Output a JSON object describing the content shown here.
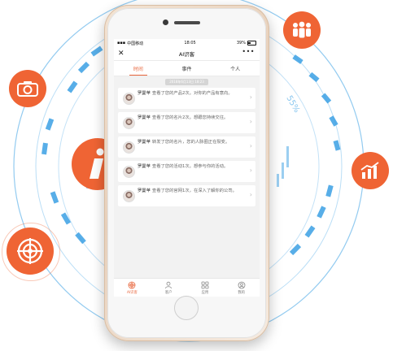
{
  "status_bar": {
    "carrier": "中国移动",
    "time": "18:05",
    "battery": "39%"
  },
  "nav": {
    "title": "AI识客",
    "close_label": "✕",
    "more_label": "•••"
  },
  "tabs": [
    {
      "label": "时间",
      "active": true
    },
    {
      "label": "事件",
      "active": false
    },
    {
      "label": "个人",
      "active": false
    }
  ],
  "date_label": "2018年6月13日 18:23",
  "feed": [
    {
      "name": "罗曼苹",
      "text": "查看了您的产品2次。对你的产品有意向。"
    },
    {
      "name": "罗曼苹",
      "text": "查看了您的名片2次。想跟您持续交往。"
    },
    {
      "name": "罗曼苹",
      "text": "转发了您的名片，您的人脉圈正在裂变。"
    },
    {
      "name": "罗曼苹",
      "text": "查看了您的活动1次。想参与你的活动。"
    },
    {
      "name": "罗曼苹",
      "text": "查看了您的官网1次，在深入了解你的公司。"
    }
  ],
  "tabbar": [
    {
      "label": "AI识客",
      "icon": "radar-icon",
      "active": true
    },
    {
      "label": "客户",
      "icon": "person-icon",
      "active": false
    },
    {
      "label": "应用",
      "icon": "grid-icon",
      "active": false
    },
    {
      "label": "我的",
      "icon": "profile-icon",
      "active": false
    }
  ],
  "decor": {
    "watermark_text": "55%",
    "accent_color": "#ef6434",
    "ring_color": "#3aa0e4",
    "badge_icons": [
      "group-icon",
      "camera-icon",
      "info-icon",
      "growth-chart-icon",
      "target-icon"
    ]
  }
}
